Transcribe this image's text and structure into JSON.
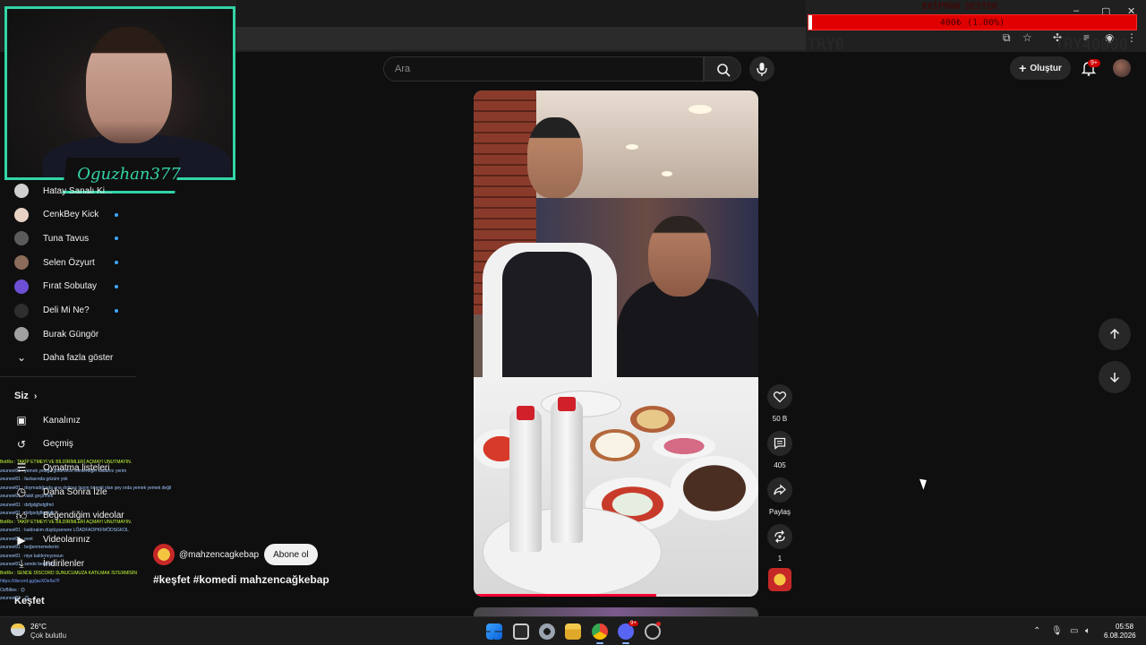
{
  "browser": {
    "window_controls": [
      "–",
      "▢",
      "✕"
    ]
  },
  "overlay": {
    "title": "EKİPMAN DESTEK",
    "goal_text": "400₺ (1.00%)",
    "goal_progress_percent": 1.0,
    "left_code": "TRY0",
    "right_code": "TRY40000"
  },
  "webcam": {
    "streamer_name": "Oguzhan377"
  },
  "header": {
    "search_placeholder": "Ara",
    "create_label": "Oluştur",
    "notification_count": "9+"
  },
  "sidebar": {
    "subscriptions": [
      {
        "label": "Hatay Sanalı Ki...",
        "avatar_color": "#cfcfcf",
        "live": false
      },
      {
        "label": "CenkBey Kick",
        "avatar_color": "#e8d2c5",
        "live": true
      },
      {
        "label": "Tuna Tavus",
        "avatar_color": "#5b5b5b",
        "live": true
      },
      {
        "label": "Selen Özyurt",
        "avatar_color": "#8b6b5a",
        "live": true
      },
      {
        "label": "Fırat Sobutay",
        "avatar_color": "#6c4fd4",
        "live": true
      },
      {
        "label": "Deli Mi Ne?",
        "avatar_color": "#2e2e2e",
        "live": true
      },
      {
        "label": "Burak Güngör",
        "avatar_color": "#a0a0a0",
        "live": false
      }
    ],
    "show_more_label": "Daha fazla göster",
    "you_section_label": "Siz",
    "you_items": [
      {
        "label": "Kanalınız",
        "icon": "channel-icon"
      },
      {
        "label": "Geçmiş",
        "icon": "history-icon"
      },
      {
        "label": "Oynatma listeleri",
        "icon": "playlist-icon"
      },
      {
        "label": "Daha Sonra İzle",
        "icon": "watch-later-icon"
      },
      {
        "label": "Beğendiğim videolar",
        "icon": "like-icon"
      },
      {
        "label": "Videolarınız",
        "icon": "your-videos-icon"
      },
      {
        "label": "İndirilenler",
        "icon": "download-icon"
      }
    ],
    "explore_label": "Keşfet"
  },
  "chat": [
    {
      "kind": "bot",
      "text": "BotRix : TAKİP ETMEYİ VE BİLDİRİMLERİ AÇMAYI UNUTMAYIN."
    },
    {
      "kind": "usr",
      "text": "zeuneel01 : yemek yediğe götürünce isimlerdiğin kadarını yerim"
    },
    {
      "kind": "usr",
      "text": "zeuneel01 : fazlasında gözüm yok"
    },
    {
      "kind": "usr",
      "text": "zeuneel01 : doymadığında ona dolmaz lazım önemli olan şey orda yemek yemek değil"
    },
    {
      "kind": "usr",
      "text": "zeuneel01 : vakit geçirmek"
    },
    {
      "kind": "usr",
      "text": "zeuneel01 : dsfgdgfsdgfmö"
    },
    {
      "kind": "usr",
      "text": "zeuneel01 : dsfgsdgfksdgfk"
    },
    {
      "kind": "bot",
      "text": "BotRix : TAKİP ETMEYİ VE BİLDİRİMLERİ AÇMAYI UNUTMAYIN."
    },
    {
      "kind": "usr",
      "text": "zeuneel01 : kaldıralım düştüysenere LÖADFAOPKFMÖDSGKOL"
    },
    {
      "kind": "usr",
      "text": "zeuneel01 : evet"
    },
    {
      "kind": "usr",
      "text": "zeuneel01 : beğenmemelerini"
    },
    {
      "kind": "usr",
      "text": "zeuneel01 : niye kaldırmıyorsun"
    },
    {
      "kind": "usr",
      "text": "zeuneel01 : sende benimim"
    },
    {
      "kind": "bot",
      "text": "BotRix : SENDE DİSCORD SUNUCUMUZA KATILMAK İSTERMİSİN"
    },
    {
      "kind": "link",
      "text": "https://discord.gg/jazXDe9a7F"
    },
    {
      "kind": "usr",
      "text": "OzBiltes : 😊"
    },
    {
      "kind": "usr",
      "text": "zeuneel01 : 😊"
    }
  ],
  "short": {
    "channel_handle": "@mahzencagkebap",
    "subscribe_label": "Abone ol",
    "description": "#keşfet #komedi mahzencağkebap",
    "progress_fraction": 0.64
  },
  "actions": [
    {
      "name": "like",
      "label": "50 B"
    },
    {
      "name": "comment",
      "label": "405"
    },
    {
      "name": "share",
      "label": "Paylaş"
    },
    {
      "name": "remix",
      "label": "1"
    }
  ],
  "taskbar": {
    "temperature": "26°C",
    "weather_desc": "Çok bulutlu",
    "time": "05:58",
    "date": "6.08.2026",
    "discord_badge": "9+"
  },
  "colors": {
    "accent_teal": "#33d4a7",
    "yt_red": "#ff0033",
    "live_dot": "#3ea6ff"
  }
}
